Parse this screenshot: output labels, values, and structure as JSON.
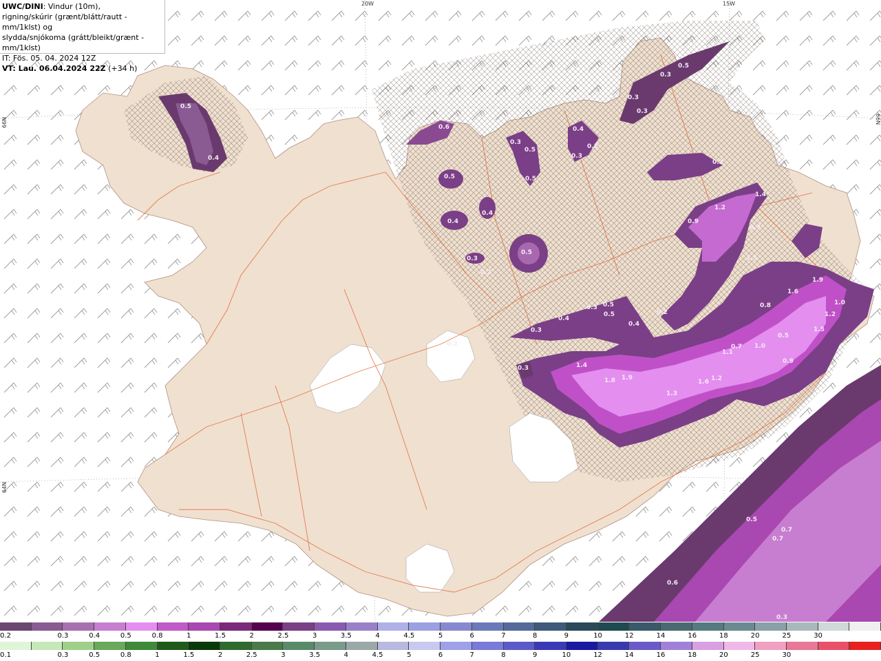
{
  "title": {
    "model": "UWC/DINI",
    "line1_rest": ": Vindur (10m),",
    "line2": "rigning/skúrir (grænt/blátt/rautt - mm/1klst) og",
    "line3": "slydda/snjókoma (grátt/bleikt/grænt - mm/1klst)",
    "it": "IT: Fös. 05. 04. 2024 12Z",
    "vt_bold": "VT: Lau. 06.04.2024 22Z",
    "vt_offset": " (+34 h)"
  },
  "grid_labels": {
    "top_20w": "20W",
    "top_15w": "15W",
    "left_66n": "66N",
    "left_64n": "64N",
    "right_66n": "66N"
  },
  "map_values": [
    {
      "t": "0.5"
    },
    {
      "t": "0.4"
    },
    {
      "t": "0.6"
    },
    {
      "t": "0.3"
    },
    {
      "t": "0.5"
    },
    {
      "t": "0.5"
    },
    {
      "t": "0.4"
    },
    {
      "t": "0.2"
    },
    {
      "t": "0.3"
    },
    {
      "t": "0.3"
    },
    {
      "t": "0.5"
    },
    {
      "t": "0.3"
    },
    {
      "t": "0.3"
    },
    {
      "t": "0.5"
    },
    {
      "t": "0.4"
    },
    {
      "t": "0.4"
    },
    {
      "t": "0.3"
    },
    {
      "t": "0.5"
    },
    {
      "t": "0.2"
    },
    {
      "t": "0.2"
    },
    {
      "t": "1.2"
    },
    {
      "t": "1.4"
    },
    {
      "t": "0.9"
    },
    {
      "t": "0.7"
    },
    {
      "t": "1.5"
    },
    {
      "t": "1.9"
    },
    {
      "t": "1.6"
    },
    {
      "t": "1.0"
    },
    {
      "t": "1.2"
    },
    {
      "t": "1.5"
    },
    {
      "t": "0.8"
    },
    {
      "t": "0.5"
    },
    {
      "t": "0.4"
    },
    {
      "t": "0.3"
    },
    {
      "t": "0.5"
    },
    {
      "t": "0.5"
    },
    {
      "t": "0.4"
    },
    {
      "t": "0.3"
    },
    {
      "t": "0.2"
    },
    {
      "t": "1.1"
    },
    {
      "t": "1.0"
    },
    {
      "t": "0.7"
    },
    {
      "t": "0.9"
    },
    {
      "t": "0.3"
    },
    {
      "t": "1.4"
    },
    {
      "t": "1.8"
    },
    {
      "t": "1.9"
    },
    {
      "t": "1.3"
    },
    {
      "t": "1.6"
    },
    {
      "t": "1.2"
    },
    {
      "t": "0.5"
    },
    {
      "t": "0.7"
    },
    {
      "t": "0.7"
    },
    {
      "t": "0.6"
    },
    {
      "t": "0.3"
    },
    {
      "t": "0.2"
    }
  ],
  "legend_snow": {
    "colors": [
      "#6a4870",
      "#8a5a92",
      "#a870b0",
      "#c77ed0",
      "#e48ef0",
      "#c05ac8",
      "#a848b0",
      "#7a2a7a",
      "#550050",
      "#7a3f86",
      "#8a5ab0",
      "#9a80c8",
      "#b0b0e8",
      "#9aa0e0",
      "#8888d0",
      "#6a7ab8",
      "#556a9a",
      "#3f5a7a",
      "#2a4a5a",
      "#1f4a50",
      "#3a5a6a",
      "#4a6a72",
      "#557a80",
      "#6a8a90",
      "#8aa0a8",
      "#a8b8bc",
      "#d0d8d8",
      "#f0f0f0"
    ],
    "labels": [
      "0.2",
      "0.3",
      "0.4",
      "0.5",
      "0.8",
      "1",
      "1.5",
      "2",
      "2.5",
      "3",
      "3.5",
      "4",
      "4.5",
      "5",
      "6",
      "7",
      "8",
      "9",
      "10",
      "12",
      "14",
      "16",
      "18",
      "20",
      "25",
      "30"
    ]
  },
  "legend_rain": {
    "colors": [
      "#dff5d8",
      "#c6e8b8",
      "#9fd08a",
      "#6aa85a",
      "#3f8a3a",
      "#1f5a1a",
      "#0a3a0a",
      "#2f6a2f",
      "#4a7a4a",
      "#5a8a6a",
      "#7a9a8a",
      "#9aa8a8",
      "#b8b8e0",
      "#c8c8f0",
      "#a0a0e8",
      "#7a7ad8",
      "#5a5ac8",
      "#3a3ab8",
      "#1a1aa0",
      "#3a3ab0",
      "#6a5ac8",
      "#a080d8",
      "#d8a0e0",
      "#f0b8e8",
      "#f0a0c0",
      "#e87898",
      "#e8506a",
      "#e82020"
    ],
    "labels": [
      "0.1",
      "0.3",
      "0.5",
      "0.8",
      "1",
      "1.5",
      "2",
      "2.5",
      "3",
      "3.5",
      "4",
      "4.5",
      "5",
      "6",
      "7",
      "8",
      "9",
      "10",
      "12",
      "14",
      "16",
      "18",
      "20",
      "25",
      "30"
    ]
  }
}
